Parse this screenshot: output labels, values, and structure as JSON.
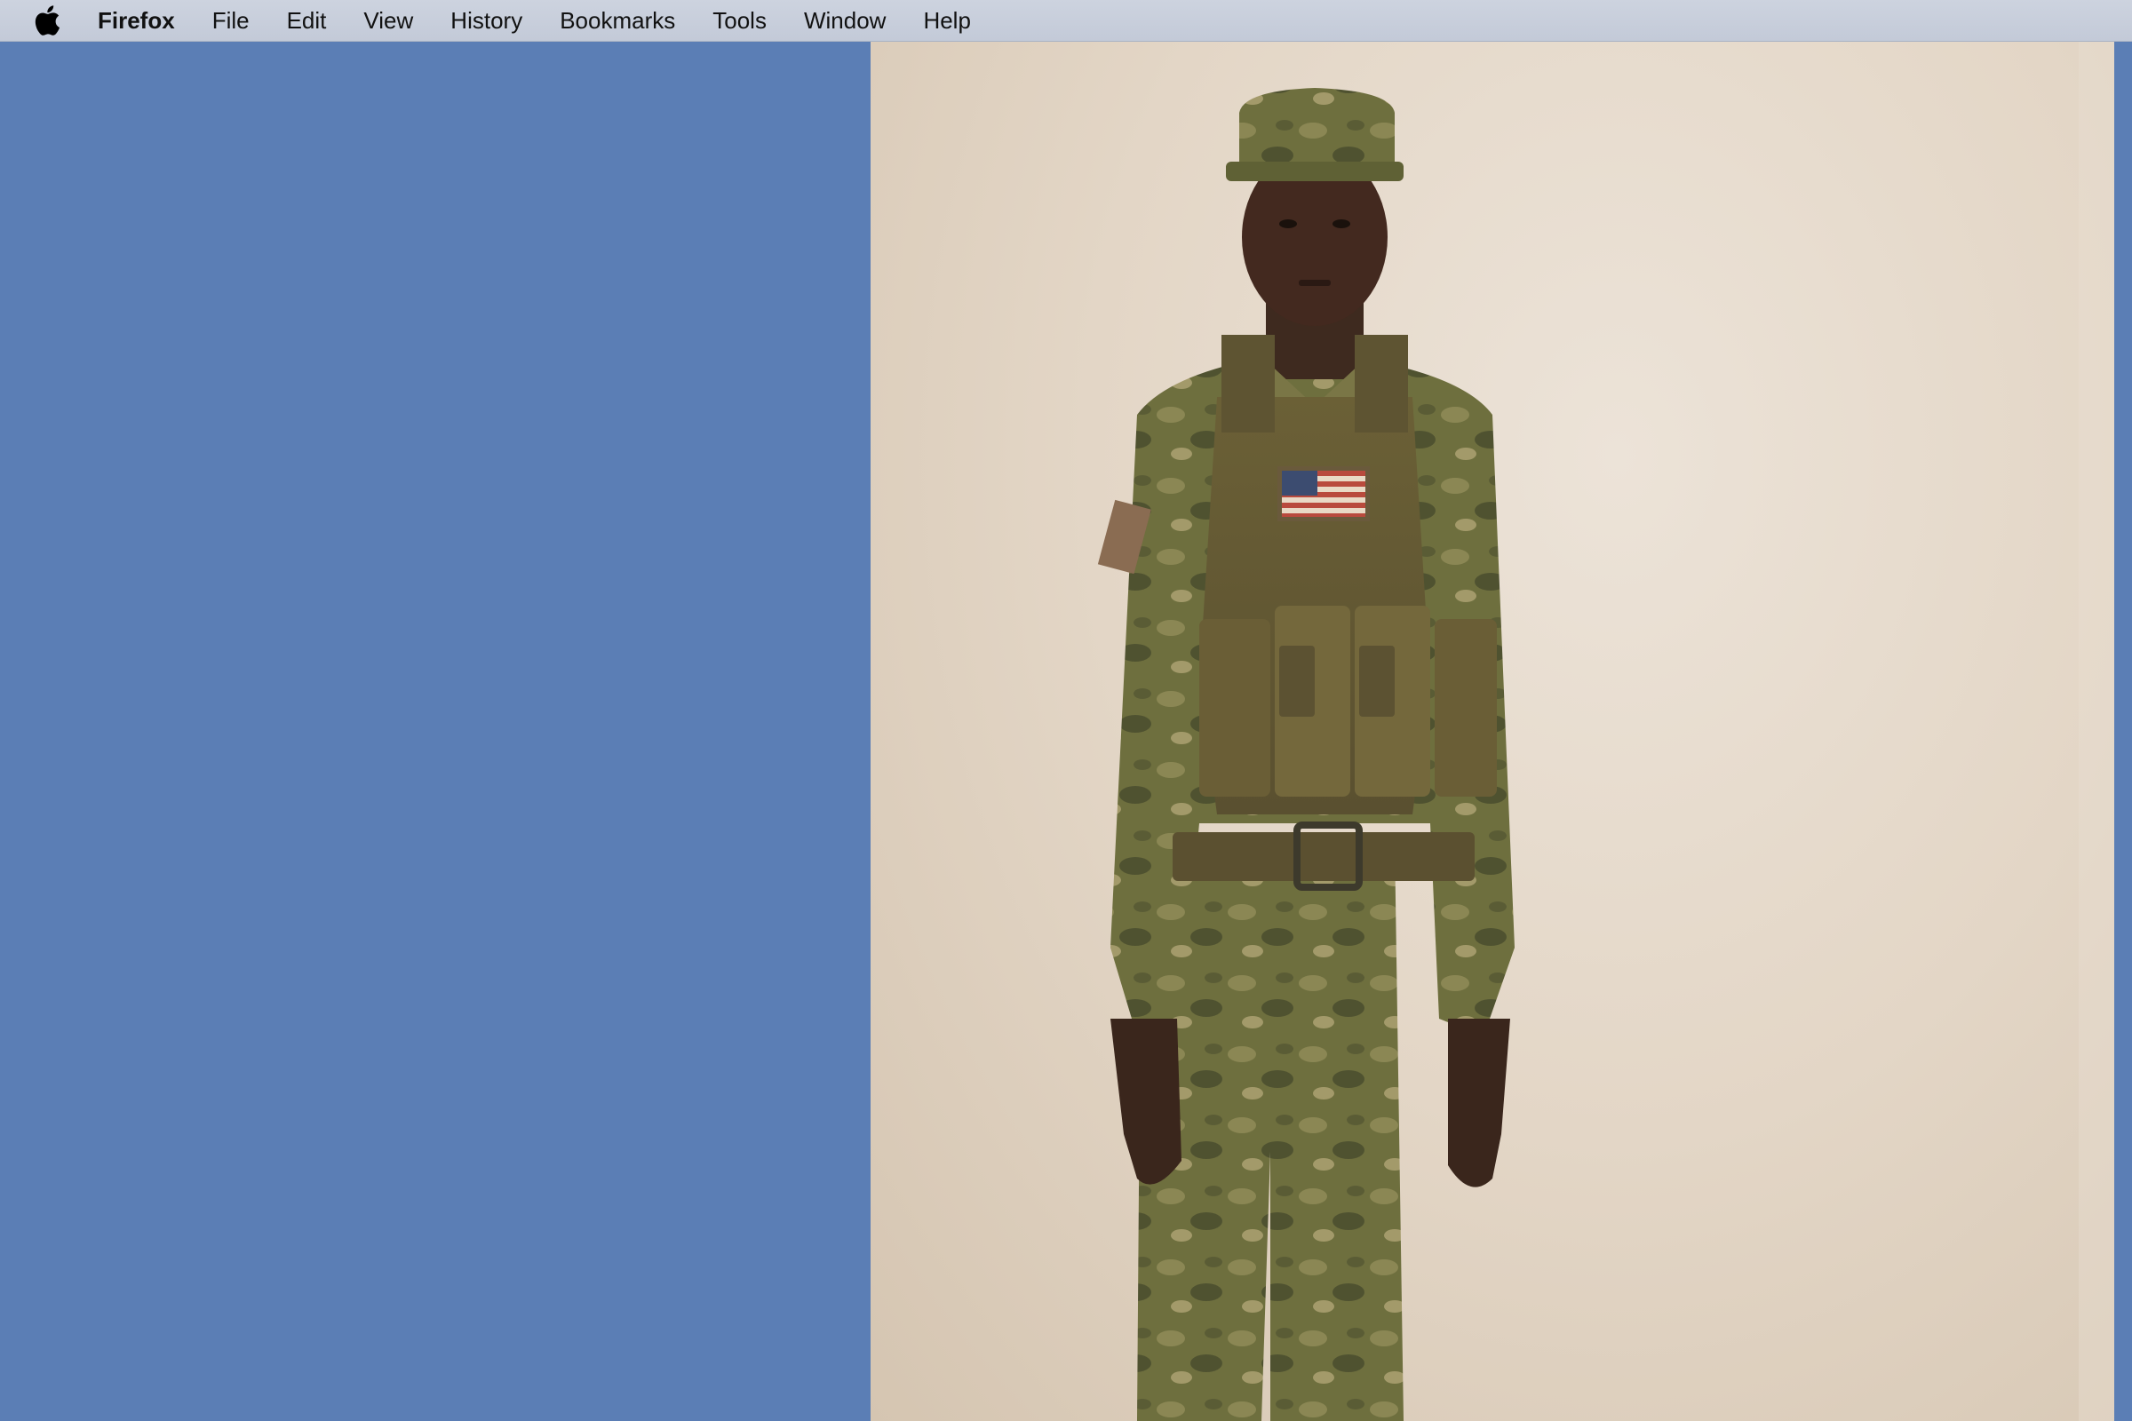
{
  "menubar": {
    "apple_icon": "apple-icon",
    "app_name": "Firefox",
    "items": [
      {
        "label": "File"
      },
      {
        "label": "Edit"
      },
      {
        "label": "View"
      },
      {
        "label": "History"
      },
      {
        "label": "Bookmarks"
      },
      {
        "label": "Tools"
      },
      {
        "label": "Window"
      },
      {
        "label": "Help"
      }
    ]
  },
  "desktop": {
    "background_color": "#5b7eb5"
  },
  "photo": {
    "background_color": "#e6dccf",
    "uniform_color": "#6b6b3a"
  }
}
